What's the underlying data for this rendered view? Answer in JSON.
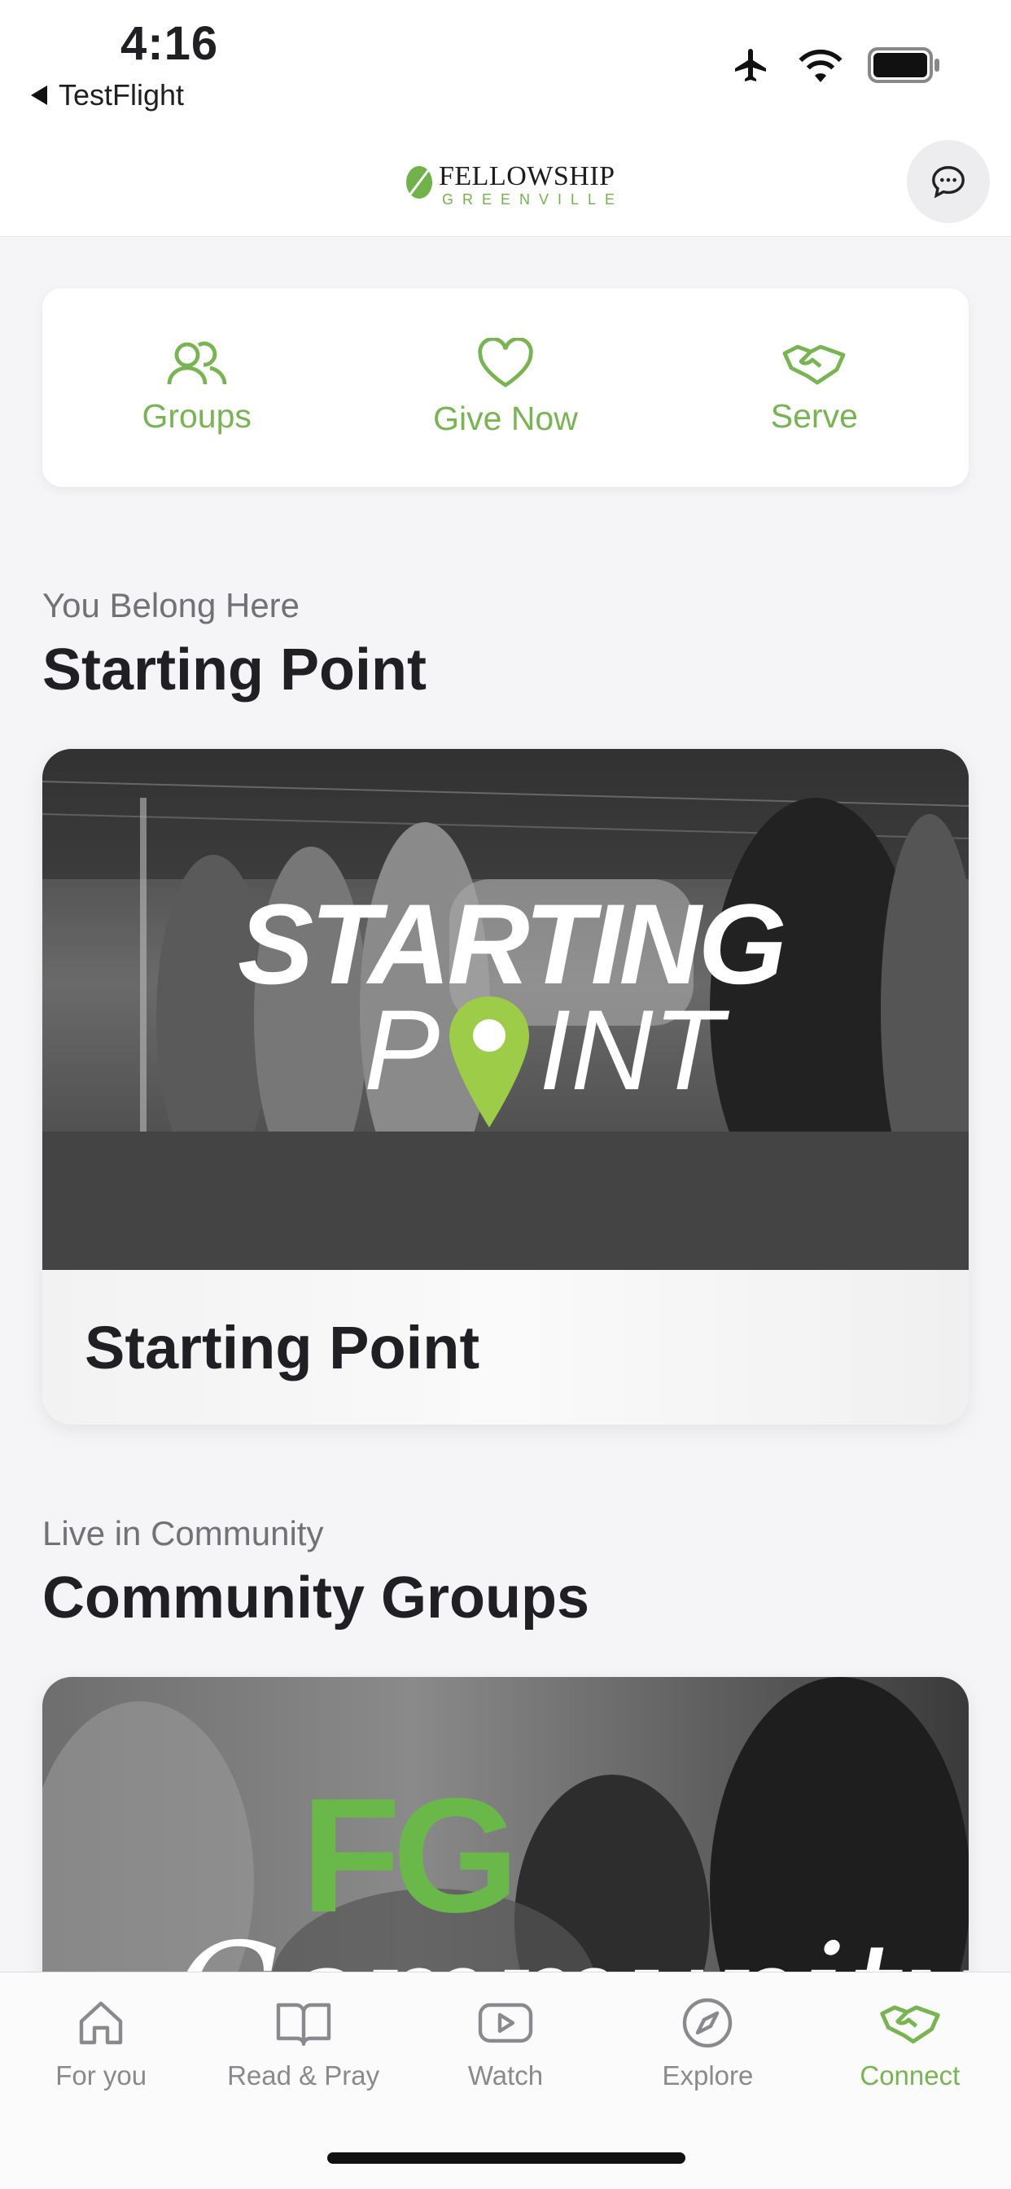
{
  "status": {
    "time": "4:16",
    "back_app": "TestFlight"
  },
  "header": {
    "brand_top": "FELLOWSHIP",
    "brand_bottom": "GREENVILLE"
  },
  "quick_actions": [
    {
      "label": "Groups",
      "icon": "groups-icon"
    },
    {
      "label": "Give Now",
      "icon": "heart-icon"
    },
    {
      "label": "Serve",
      "icon": "handshake-icon"
    }
  ],
  "sections": [
    {
      "eyebrow": "You Belong Here",
      "title": "Starting Point",
      "card_title": "Starting Point",
      "hero_text_line1": "STARTING",
      "hero_text_line2_a": "P",
      "hero_text_line2_b": "INT"
    },
    {
      "eyebrow": "Live in Community",
      "title": "Community Groups",
      "hero_logo": "FG",
      "hero_script": "Community"
    }
  ],
  "tabs": [
    {
      "label": "For you",
      "icon": "home-icon",
      "active": false
    },
    {
      "label": "Read & Pray",
      "icon": "book-icon",
      "active": false
    },
    {
      "label": "Watch",
      "icon": "play-icon",
      "active": false
    },
    {
      "label": "Explore",
      "icon": "compass-icon",
      "active": false
    },
    {
      "label": "Connect",
      "icon": "handshake-icon",
      "active": true
    }
  ],
  "colors": {
    "accent": "#78b552",
    "background": "#f5f5f8",
    "text": "#1f1f24",
    "muted": "#717176"
  }
}
